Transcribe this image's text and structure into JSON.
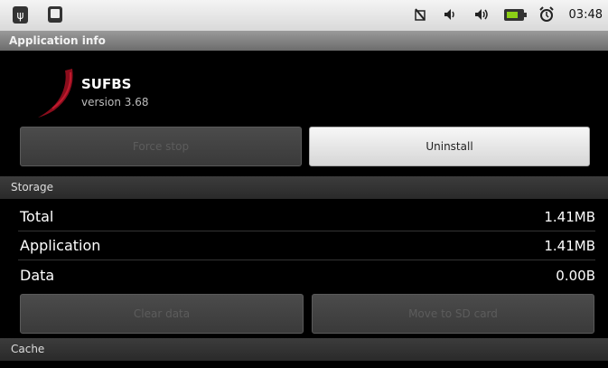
{
  "status_bar": {
    "time": "03:48"
  },
  "title_bar": {
    "title": "Application info"
  },
  "app": {
    "name": "SUFBS",
    "version": "version 3.68"
  },
  "buttons": {
    "force_stop": "Force stop",
    "uninstall": "Uninstall",
    "clear_data": "Clear data",
    "move_to_sd": "Move to SD card"
  },
  "storage": {
    "header": "Storage",
    "rows": [
      {
        "label": "Total",
        "value": "1.41MB"
      },
      {
        "label": "Application",
        "value": "1.41MB"
      },
      {
        "label": "Data",
        "value": "0.00B"
      }
    ]
  },
  "cache": {
    "header": "Cache"
  }
}
